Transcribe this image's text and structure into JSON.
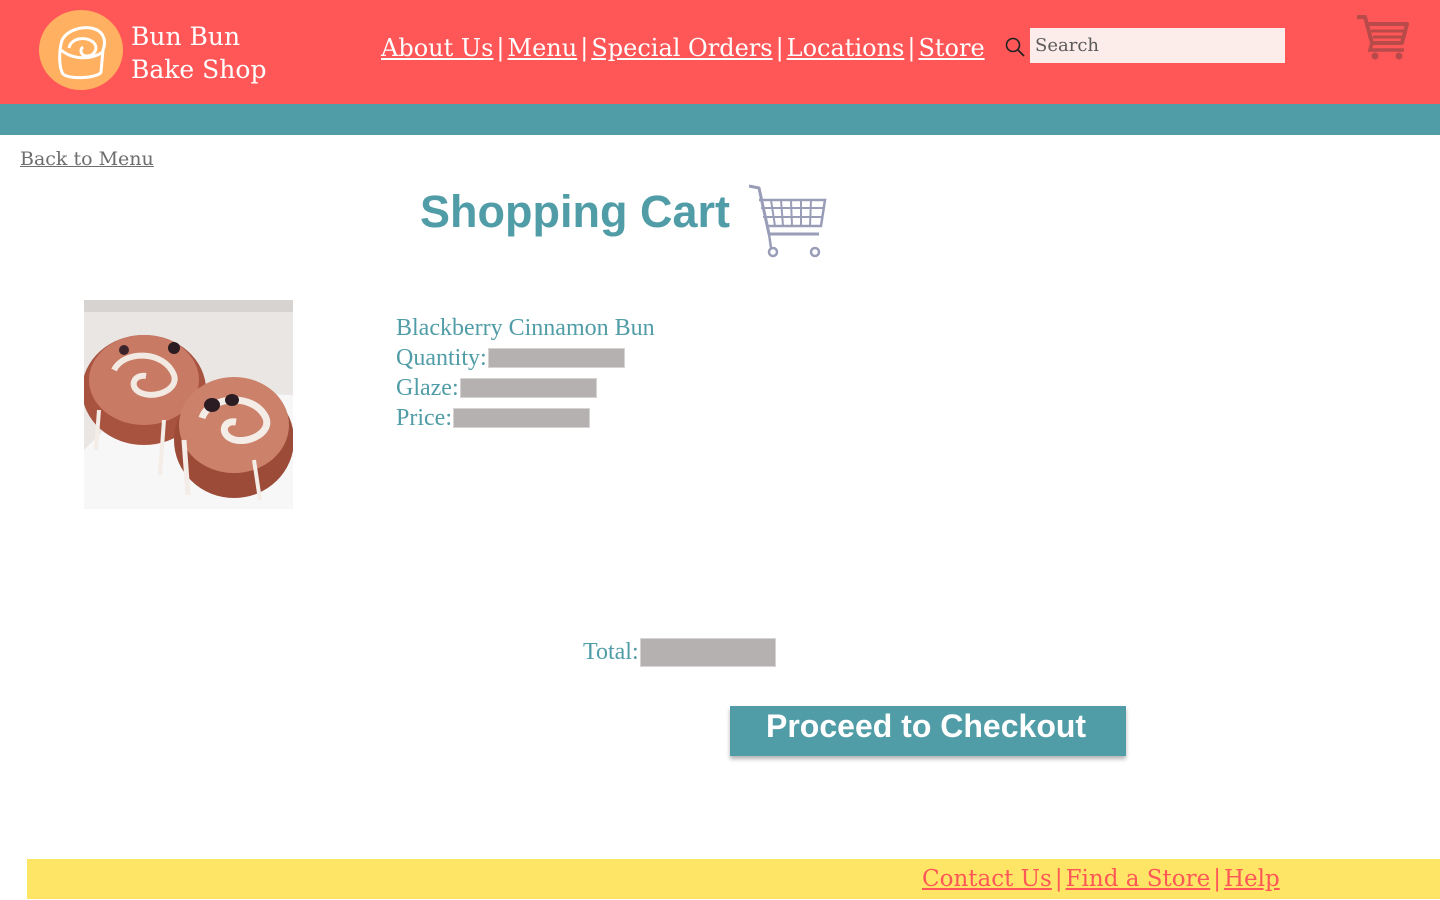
{
  "header": {
    "brand_line1": "Bun Bun",
    "brand_line2": "Bake Shop",
    "logo_icon": "cinnamon-bun-icon",
    "nav": [
      {
        "label": "About Us"
      },
      {
        "label": "Menu"
      },
      {
        "label": "Special Orders"
      },
      {
        "label": "Locations"
      },
      {
        "label": "Store"
      }
    ],
    "separator": "|",
    "search": {
      "placeholder": "Search",
      "value": "",
      "icon": "search-icon"
    },
    "cart_icon": "cart-icon"
  },
  "page": {
    "back_link": "Back to Menu",
    "title": "Shopping Cart",
    "title_icon": "shopping-cart-icon"
  },
  "cart_item": {
    "name": "Blackberry Cinnamon Bun",
    "image_alt": "Blackberry cinnamon buns with glaze",
    "quantity_label": "Quantity:",
    "quantity_value": "",
    "glaze_label": "Glaze:",
    "glaze_value": "",
    "price_label": "Price:",
    "price_value": ""
  },
  "summary": {
    "total_label": "Total:",
    "total_value": "",
    "checkout_label": "Proceed to Checkout"
  },
  "footer": {
    "links": [
      {
        "label": "Contact Us"
      },
      {
        "label": "Find a Store"
      },
      {
        "label": "Help"
      }
    ],
    "separator": "|"
  },
  "colors": {
    "header_bg": "#ff5757",
    "teal_accent": "#519da7",
    "logo_orange": "#ffb061",
    "footer_bg": "#ffe566",
    "field_gray": "#b5b1b1"
  }
}
